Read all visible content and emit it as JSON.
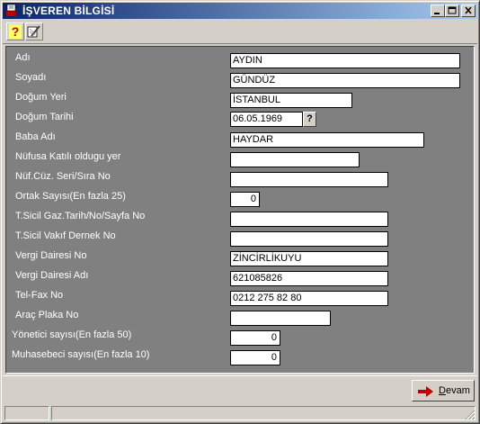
{
  "window": {
    "title": "İŞVEREN BİLGİSİ"
  },
  "fields": [
    {
      "label": "Adı",
      "value": "AYDIN"
    },
    {
      "label": "Soyadı",
      "value": "GÜNDÜZ"
    },
    {
      "label": "Doğum Yeri",
      "value": "İSTANBUL"
    },
    {
      "label": "Doğum Tarihi",
      "value": "06.05.1969"
    },
    {
      "label": "Baba Adı",
      "value": "HAYDAR"
    },
    {
      "label": "Nüfusa Katılı oldugu yer",
      "value": ""
    },
    {
      "label": "Nüf.Cüz. Seri/Sıra No",
      "value": ""
    },
    {
      "label": "Ortak Sayısı(En fazla 25)",
      "value": "0"
    },
    {
      "label": "T.Sicil Gaz.Tarih/No/Sayfa No",
      "value": ""
    },
    {
      "label": "T.Sicil Vakıf Dernek No",
      "value": ""
    },
    {
      "label": "Vergi Dairesi No",
      "value": "ZİNCİRLİKUYU"
    },
    {
      "label": "Vergi Dairesi Adı",
      "value": "621085826"
    },
    {
      "label": "Tel-Fax No",
      "value": "0212 275 82 80"
    },
    {
      "label": "Araç Plaka No",
      "value": ""
    },
    {
      "label": "Yönetici sayısı(En fazla 50)",
      "value": "0"
    },
    {
      "label": "Muhasebeci sayısı(En fazla 10)",
      "value": "0"
    }
  ],
  "date_picker_label": "?",
  "buttons": {
    "devam_first": "D",
    "devam_rest": "evam"
  },
  "icons": {
    "help": "help-icon",
    "tool": "tools-icon"
  }
}
